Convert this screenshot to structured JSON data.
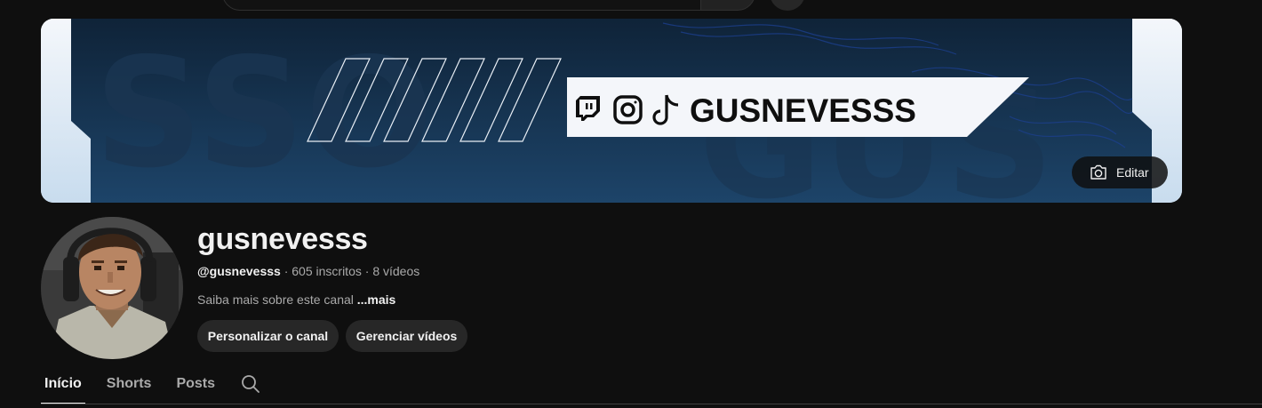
{
  "banner": {
    "brand_text": "GUSNEVESSS",
    "edit_label": "Editar",
    "social_icons": [
      "twitch-icon",
      "instagram-icon",
      "tiktok-icon"
    ]
  },
  "channel": {
    "name": "gusnevesss",
    "handle": "@gusnevesss",
    "separator1": " · ",
    "subscribers": "605 inscritos",
    "separator2": " · ",
    "videos": "8 vídeos",
    "description": "Saiba mais sobre este canal ",
    "more_label": "...mais"
  },
  "actions": {
    "customize_label": "Personalizar o canal",
    "manage_label": "Gerenciar vídeos"
  },
  "tabs": [
    {
      "label": "Início",
      "active": true
    },
    {
      "label": "Shorts",
      "active": false
    },
    {
      "label": "Posts",
      "active": false
    }
  ],
  "colors": {
    "background": "#0f0f0f",
    "button_bg": "#272727",
    "banner_dark": "#17304a",
    "secondary_text": "#aaaaaa"
  }
}
